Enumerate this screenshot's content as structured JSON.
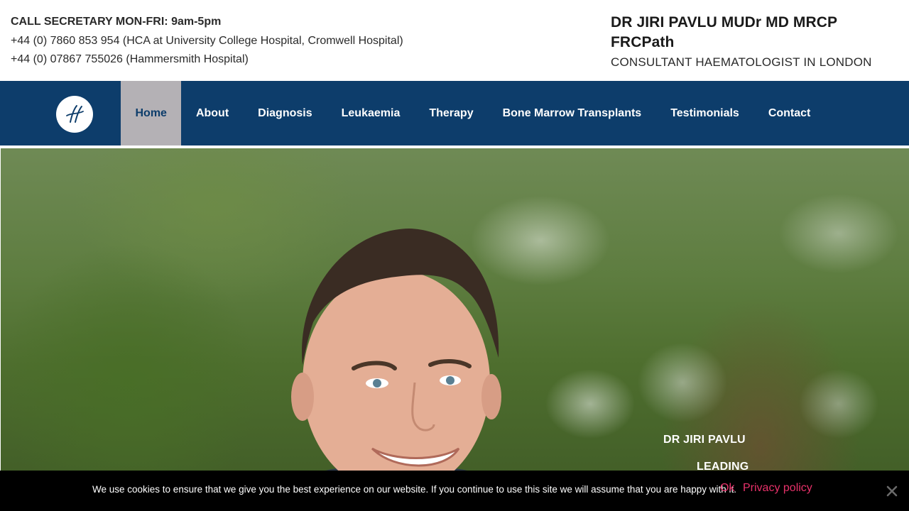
{
  "header": {
    "call_line": "CALL SECRETARY MON-FRI: 9am-5pm",
    "phone_1": "+44 (0) 7860 853 954 (HCA at University College Hospital, Cromwell Hospital)",
    "phone_2": "+44 (0) 07867 755026 (Hammersmith Hospital)",
    "doctor_name": "DR JIRI PAVLU MUDr MD MRCP FRCPath",
    "doctor_role": "CONSULTANT HAEMATOLOGIST IN LONDON"
  },
  "nav": {
    "logo_icon": "h-monogram-logo",
    "items": [
      {
        "label": "Home",
        "active": true
      },
      {
        "label": "About",
        "active": false
      },
      {
        "label": "Diagnosis",
        "active": false
      },
      {
        "label": "Leukaemia",
        "active": false
      },
      {
        "label": "Therapy",
        "active": false
      },
      {
        "label": "Bone Marrow Transplants",
        "active": false
      },
      {
        "label": "Testimonials",
        "active": false
      },
      {
        "label": "Contact",
        "active": false
      }
    ]
  },
  "hero": {
    "caption_1": "DR JIRI PAVLU",
    "caption_2": "LEADING"
  },
  "cookie": {
    "text": "We use cookies to ensure that we give you the best experience on our website. If you continue to use this site we will assume that you are happy with it.",
    "ok_label": "Ok",
    "privacy_label": "Privacy policy",
    "close_icon": "close-icon"
  },
  "colors": {
    "nav_bg": "#0d3d6b",
    "nav_active_bg": "#b4b1b5",
    "cookie_bg": "#000000",
    "cookie_link": "#e8316a"
  }
}
